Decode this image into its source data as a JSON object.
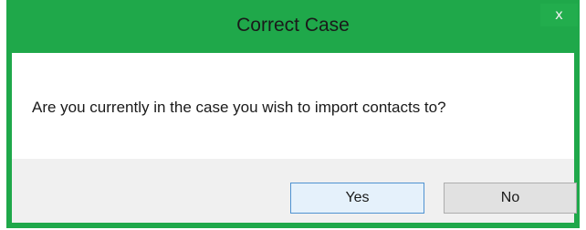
{
  "dialog": {
    "title": "Correct Case",
    "close_label": "x",
    "message": "Are you currently in the case you wish to import contacts to?",
    "buttons": {
      "yes_label": "Yes",
      "no_label": "No"
    }
  }
}
